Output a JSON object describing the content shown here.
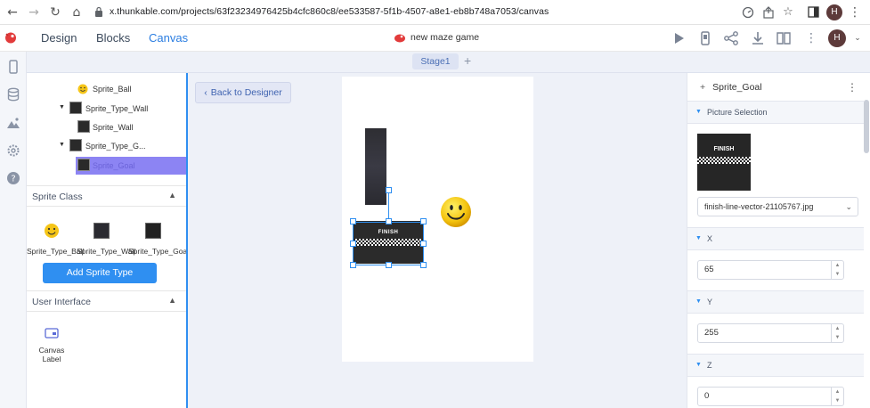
{
  "browser": {
    "url": "x.thunkable.com/projects/63f23234976425b4cfc860c8/ee533587-5f1b-4507-a8e1-eb8b748a7053/canvas",
    "avatar_letter": "H"
  },
  "header": {
    "tabs": [
      "Design",
      "Blocks",
      "Canvas"
    ],
    "active_tab": "Canvas",
    "project_name": "new maze game",
    "avatar_letter": "H"
  },
  "stage": {
    "name": "Stage1",
    "add_symbol": "+"
  },
  "tree": {
    "items": [
      {
        "label": "Sprite_Ball",
        "type": "sprite"
      },
      {
        "label": "Sprite_Type_Wall",
        "type": "group"
      },
      {
        "label": "Sprite_Wall",
        "type": "sprite"
      },
      {
        "label": "Sprite_Type_G...",
        "type": "group"
      },
      {
        "label": "Sprite_Goal",
        "type": "sprite",
        "selected": true
      }
    ]
  },
  "sprite_class": {
    "title": "Sprite Class",
    "types": [
      "Sprite_Type_Ball",
      "Sprite_Type_Wall",
      "Sprite_Type_Goal"
    ],
    "add_button": "Add Sprite Type"
  },
  "user_interface": {
    "title": "User Interface",
    "components": [
      "Canvas Label"
    ]
  },
  "canvas": {
    "back_button": "Back to Designer",
    "finish_text": "FINISH"
  },
  "properties": {
    "title": "Sprite_Goal",
    "picture_section": "Picture Selection",
    "picture_file": "finish-line-vector-21105767.jpg",
    "picture_text": "FINISH",
    "x_label": "X",
    "x_value": "65",
    "y_label": "Y",
    "y_value": "255",
    "z_label": "Z",
    "z_value": "0"
  },
  "colors": {
    "accent": "#2f8ff1",
    "selected_row": "#8c84f3",
    "stage_bg": "#eef1f8"
  }
}
